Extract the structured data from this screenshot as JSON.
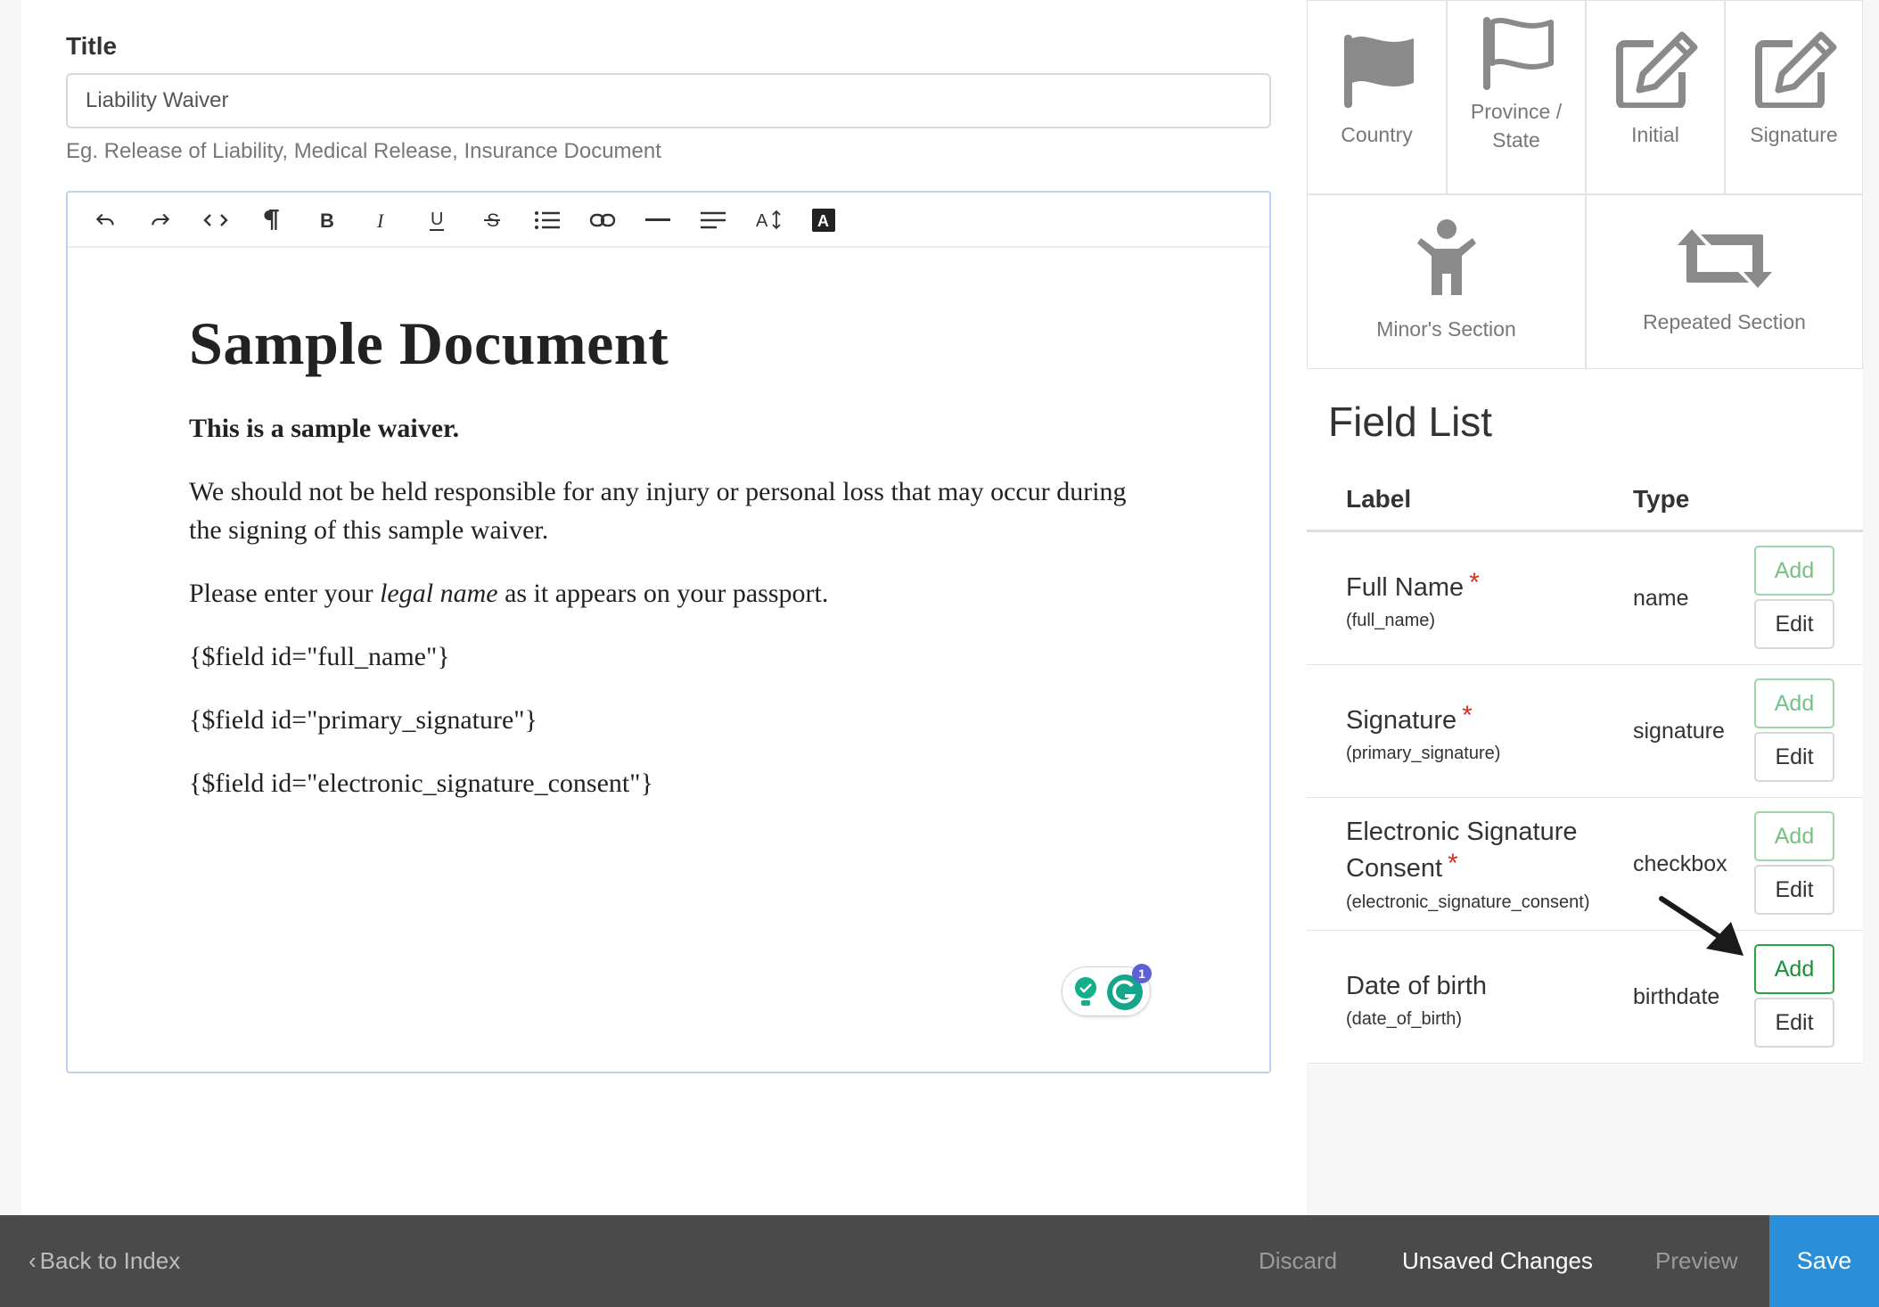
{
  "form": {
    "title_label": "Title",
    "title_value": "Liability Waiver",
    "title_help": "Eg. Release of Liability, Medical Release, Insurance Document"
  },
  "toolbar": {
    "buttons": [
      "undo-icon",
      "redo-icon",
      "code-icon",
      "paragraph-icon",
      "bold-icon",
      "italic-icon",
      "underline-icon",
      "strikethrough-icon",
      "bullet-list-icon",
      "link-icon",
      "horizontal-rule-icon",
      "align-icon",
      "font-size-icon",
      "text-color-icon"
    ]
  },
  "document": {
    "heading": "Sample Document",
    "lead": "This is a sample waiver.",
    "para1": "We should not be held responsible for any injury or personal loss that may occur during the signing of this sample waiver.",
    "para2_before": "Please enter your ",
    "para2_em": "legal name",
    "para2_after": " as it appears on your passport.",
    "field1": "{$field id=\"full_name\"}",
    "field2": "{$field id=\"primary_signature\"}",
    "field3": "{$field id=\"electronic_signature_consent\"}",
    "grammarly_badge": "1"
  },
  "tiles": [
    {
      "label": "Country",
      "icon": "flag-filled-icon"
    },
    {
      "label": "Province / State",
      "icon": "flag-outline-icon"
    },
    {
      "label": "Initial",
      "icon": "edit-icon"
    },
    {
      "label": "Signature",
      "icon": "edit-icon"
    },
    {
      "label": "Minor's Section",
      "icon": "child-icon"
    },
    {
      "label": "Repeated Section",
      "icon": "retweet-icon"
    }
  ],
  "field_list": {
    "title": "Field List",
    "col_label": "Label",
    "col_type": "Type",
    "add_label": "Add",
    "edit_label": "Edit",
    "rows": [
      {
        "label": "Full Name",
        "required": "*",
        "id": "(full_name)",
        "type": "name"
      },
      {
        "label": "Signature",
        "required": "*",
        "id": "(primary_signature)",
        "type": "signature"
      },
      {
        "label_line1": "Electronic Signature",
        "label_line2": "Consent",
        "required": "*",
        "id": "(electronic_signature_consent)",
        "type": "checkbox"
      },
      {
        "label": "Date of birth",
        "id": "(date_of_birth)",
        "type": "birthdate"
      }
    ]
  },
  "footer": {
    "back": "Back to Index",
    "discard": "Discard",
    "status": "Unsaved Changes",
    "preview": "Preview",
    "save": "Save"
  },
  "colors": {
    "save": "#2a8ed8",
    "footer": "#4a4a4a",
    "add_green": "#27a344",
    "required": "#d93025"
  }
}
